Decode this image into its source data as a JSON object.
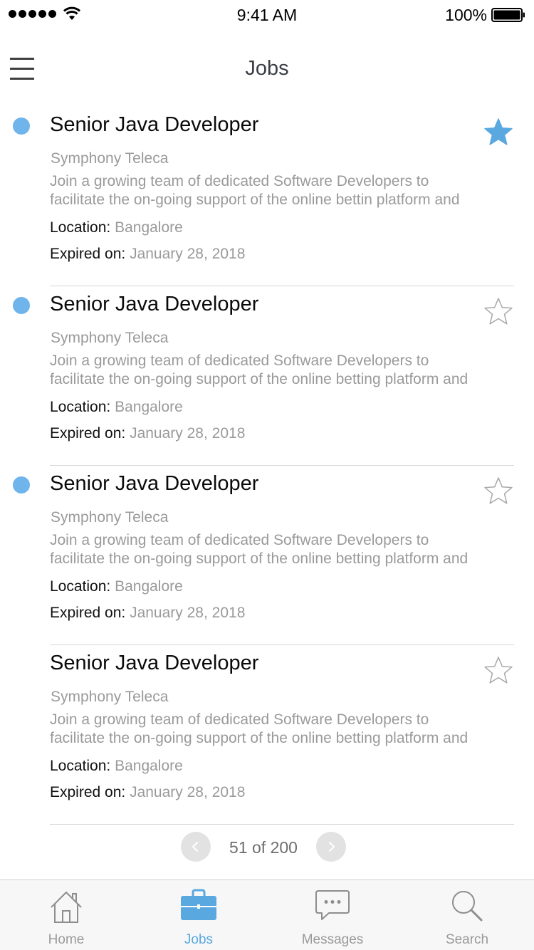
{
  "status_bar": {
    "time": "9:41 AM",
    "battery": "100%"
  },
  "nav": {
    "title": "Jobs"
  },
  "jobs": [
    {
      "title": "Senior Java Developer",
      "company": "Symphony Teleca",
      "desc_line1": "Join a growing team of dedicated Software Developers to",
      "desc_line2": "facilitate the on-going support of the online bettin platform and",
      "location_label": "Location:",
      "location": "Bangalore",
      "expired_label": "Expired on:",
      "expired": "January 28, 2018",
      "unread": true,
      "starred": true
    },
    {
      "title": "Senior Java Developer",
      "company": "Symphony Teleca",
      "desc_line1": "Join a growing team of dedicated Software Developers to",
      "desc_line2": "facilitate the on-going support of the online betting platform and",
      "location_label": "Location:",
      "location": "Bangalore",
      "expired_label": "Expired on:",
      "expired": "January 28, 2018",
      "unread": true,
      "starred": false
    },
    {
      "title": "Senior Java Developer",
      "company": "Symphony Teleca",
      "desc_line1": "Join a growing team of dedicated Software Developers to",
      "desc_line2": "facilitate the on-going support of the online betting platform and",
      "location_label": "Location:",
      "location": "Bangalore",
      "expired_label": "Expired on:",
      "expired": "January 28, 2018",
      "unread": true,
      "starred": false
    },
    {
      "title": "Senior Java Developer",
      "company": "Symphony Teleca",
      "desc_line1": "Join a growing team of dedicated Software Developers to",
      "desc_line2": "facilitate the on-going support of the online betting platform and",
      "location_label": "Location:",
      "location": "Bangalore",
      "expired_label": "Expired on:",
      "expired": "January 28, 2018",
      "unread": false,
      "starred": false
    }
  ],
  "pagination": {
    "text": "51 of 200"
  },
  "tabbar": {
    "items": [
      {
        "label": "Home",
        "icon": "home-icon",
        "active": false
      },
      {
        "label": "Jobs",
        "icon": "briefcase-icon",
        "active": true
      },
      {
        "label": "Messages",
        "icon": "chat-bubble-icon",
        "active": false
      },
      {
        "label": "Search",
        "icon": "search-icon",
        "active": false
      }
    ]
  },
  "colors": {
    "accent": "#5aa8e0",
    "unread_dot": "#6fb4ea",
    "secondary_text": "#9a9a9a",
    "divider": "#d6d6d6",
    "tabbar_bg": "#f7f7f7"
  }
}
